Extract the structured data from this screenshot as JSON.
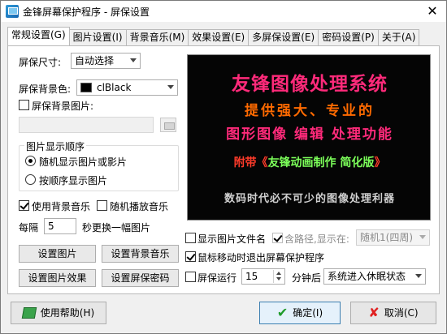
{
  "window": {
    "title": "金锋屏幕保护程序 - 屏保设置",
    "close_glyph": "✕"
  },
  "tabs": [
    {
      "label": "常规设置(G)"
    },
    {
      "label": "图片设置(I)"
    },
    {
      "label": "背景音乐(M)"
    },
    {
      "label": "效果设置(E)"
    },
    {
      "label": "多屏保设置(E)"
    },
    {
      "label": "密码设置(P)"
    },
    {
      "label": "关于(A)"
    }
  ],
  "general": {
    "size_label": "屏保尺寸:",
    "size_value": "自动选择",
    "bg_label": "屏保背景色:",
    "bg_value": "clBlack",
    "bg_color": "#000000",
    "bg_image_label": "屏保背景图片:",
    "bg_image_path": "",
    "order_group": "图片显示顺序",
    "order_random": "随机显示图片或影片",
    "order_sequence": "按顺序显示图片",
    "use_music": "使用背景音乐",
    "random_music": "随机播放音乐",
    "interval_prefix": "每隔",
    "interval_value": "5",
    "interval_suffix": "秒更换一幅图片",
    "btn_set_image": "设置图片",
    "btn_set_music": "设置背景音乐",
    "btn_image_effect": "设置图片效果",
    "btn_password": "设置屏保密码"
  },
  "preview": {
    "line1": "友锋图像处理系统",
    "line2": "提供强大、专业的",
    "line3": "图形图像 编辑 处理功能",
    "line4_prefix": "附带《",
    "line4_inner": "友锋动画制作 简化版",
    "line4_suffix": "》",
    "line5": "数码时代必不可少的图像处理利器"
  },
  "options": {
    "show_filename": "显示图片文件名",
    "full_path": "含路径,显示在:",
    "position_value": "随机1(四周)",
    "mouse_exit": "鼠标移动时退出屏幕保护程序",
    "run_label": "屏保运行",
    "run_minutes": "15",
    "after_label": "分钟后",
    "after_value": "系统进入休眠状态"
  },
  "footer": {
    "help": "使用帮助(H)",
    "ok": "确定(I)",
    "cancel": "取消(C)"
  }
}
